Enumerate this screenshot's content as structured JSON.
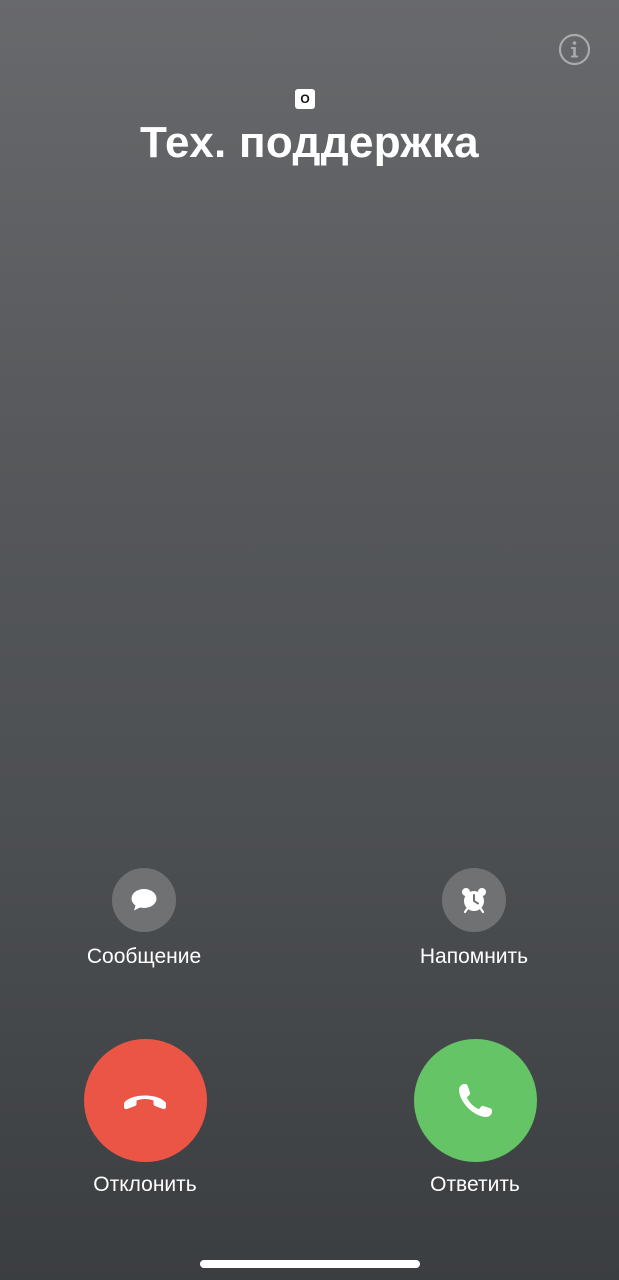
{
  "call": {
    "badge": "O",
    "caller_name": "Тех. поддержка"
  },
  "actions": {
    "message_label": "Сообщение",
    "remind_label": "Напомнить",
    "decline_label": "Отклонить",
    "accept_label": "Ответить"
  },
  "icons": {
    "info": "info-icon",
    "message": "message-bubble-icon",
    "remind": "alarm-clock-icon",
    "decline": "phone-hangup-icon",
    "accept": "phone-icon"
  },
  "colors": {
    "decline": "#eb5545",
    "accept": "#65c466",
    "small_button": "#6f7173"
  }
}
